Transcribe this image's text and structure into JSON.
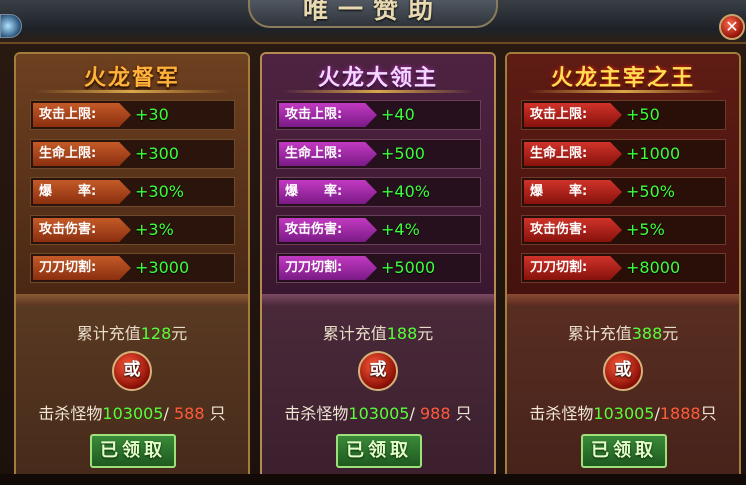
{
  "window": {
    "title": "唯一赞助",
    "close_label": "✕"
  },
  "panels": [
    {
      "name": "火龙督军",
      "stats": [
        {
          "label": "攻击上限:",
          "value": "+30"
        },
        {
          "label": "生命上限:",
          "value": "+300"
        },
        {
          "label": "爆　　率:",
          "value": "+30%"
        },
        {
          "label": "攻击伤害:",
          "value": "+3%"
        },
        {
          "label": "刀刀切割:",
          "value": "+3000"
        }
      ],
      "recharge_prefix": "累计充值",
      "recharge_amount": "128",
      "recharge_unit": "元",
      "or_label": "或",
      "kill_prefix": "击杀怪物",
      "kill_current": "103005",
      "kill_sep": "/ ",
      "kill_target": "588",
      "kill_unit": " 只",
      "claim_label": "已领取"
    },
    {
      "name": "火龙大领主",
      "stats": [
        {
          "label": "攻击上限:",
          "value": "+40"
        },
        {
          "label": "生命上限:",
          "value": "+500"
        },
        {
          "label": "爆　　率:",
          "value": "+40%"
        },
        {
          "label": "攻击伤害:",
          "value": "+4%"
        },
        {
          "label": "刀刀切割:",
          "value": "+5000"
        }
      ],
      "recharge_prefix": "累计充值",
      "recharge_amount": "188",
      "recharge_unit": "元",
      "or_label": "或",
      "kill_prefix": "击杀怪物",
      "kill_current": "103005",
      "kill_sep": "/ ",
      "kill_target": "988",
      "kill_unit": " 只",
      "claim_label": "已领取"
    },
    {
      "name": "火龙主宰之王",
      "stats": [
        {
          "label": "攻击上限:",
          "value": "+50"
        },
        {
          "label": "生命上限:",
          "value": "+1000"
        },
        {
          "label": "爆　　率:",
          "value": "+50%"
        },
        {
          "label": "攻击伤害:",
          "value": "+5%"
        },
        {
          "label": "刀刀切割:",
          "value": "+8000"
        }
      ],
      "recharge_prefix": "累计充值",
      "recharge_amount": "388",
      "recharge_unit": "元",
      "or_label": "或",
      "kill_prefix": "击杀怪物",
      "kill_current": "103005",
      "kill_sep": "/",
      "kill_target": "1888",
      "kill_unit": "只",
      "claim_label": "已领取"
    }
  ]
}
